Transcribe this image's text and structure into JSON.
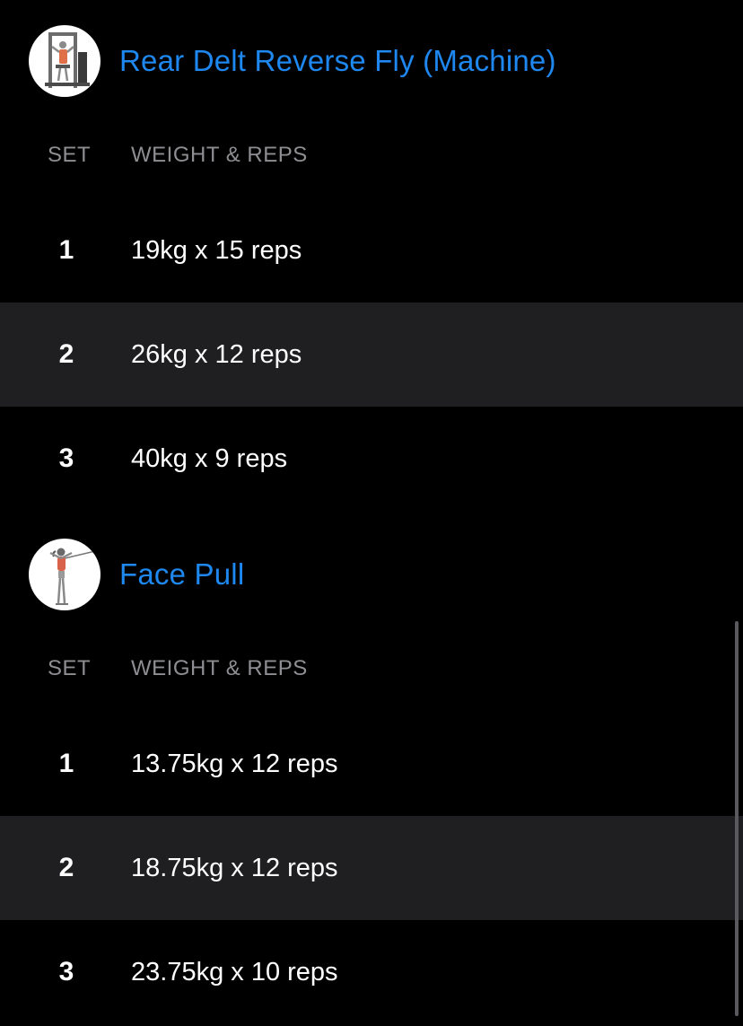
{
  "columns": {
    "set": "SET",
    "weight_reps": "WEIGHT & REPS"
  },
  "exercises": [
    {
      "title": "Rear Delt Reverse Fly (Machine)",
      "thumbnail_icon": "machine-exercise-illustration",
      "sets": [
        {
          "number": "1",
          "value": "19kg x 15 reps"
        },
        {
          "number": "2",
          "value": "26kg x 12 reps"
        },
        {
          "number": "3",
          "value": "40kg x 9 reps"
        }
      ]
    },
    {
      "title": "Face Pull",
      "thumbnail_icon": "cable-exercise-illustration",
      "sets": [
        {
          "number": "1",
          "value": "13.75kg x 12 reps"
        },
        {
          "number": "2",
          "value": "18.75kg x 12 reps"
        },
        {
          "number": "3",
          "value": "23.75kg x 10 reps"
        }
      ]
    }
  ],
  "colors": {
    "background": "#000000",
    "accent_title": "#1e88f0",
    "column_header": "#8e8e93",
    "alt_row": "#1f1f21"
  }
}
